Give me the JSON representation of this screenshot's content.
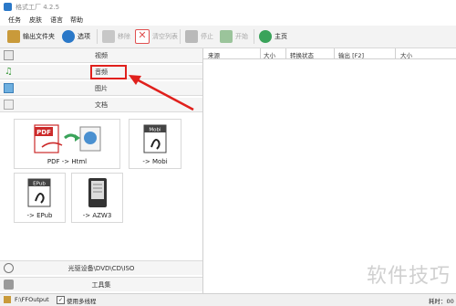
{
  "window": {
    "title": "格式工厂 4.2.5"
  },
  "menu": [
    "任务",
    "皮肤",
    "语言",
    "帮助"
  ],
  "toolbar": {
    "output_folder": "输出文件夹",
    "options": "选项",
    "remove": "移除",
    "clear_list": "清空列表",
    "stop": "停止",
    "start": "开始",
    "home": "主页"
  },
  "categories": {
    "video": "视频",
    "audio": "音频",
    "picture": "图片",
    "document": "文档",
    "disc": "光驱设备\\DVD\\CD\\ISO",
    "tools": "工具集"
  },
  "tiles": [
    {
      "label": "PDF -> Html"
    },
    {
      "label": "-> Mobi"
    },
    {
      "label": "-> EPub"
    },
    {
      "label": "-> AZW3"
    }
  ],
  "tile_badges": {
    "pdf": "PDF",
    "mobi": "Mobi",
    "epub": "EPub"
  },
  "table": {
    "columns": [
      "来源",
      "大小",
      "转换状态",
      "输出 [F2]",
      "大小"
    ]
  },
  "status": {
    "path": "F:\\FFOutput",
    "multithread": "使用多线程",
    "elapsed": "耗时：00"
  },
  "watermark": "软件技巧",
  "colors": {
    "annotation": "#e0201c",
    "accent": "#2a78c8"
  }
}
